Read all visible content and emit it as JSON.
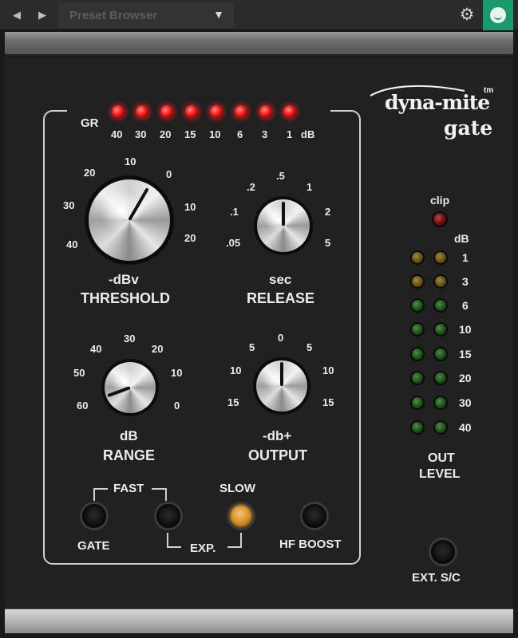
{
  "topbar": {
    "preset_label": "Preset Browser",
    "prev_icon": "◀",
    "next_icon": "▶",
    "dropdown_icon": "▼",
    "gear_icon": "⚙"
  },
  "logo": {
    "line1": "dyna-mite",
    "line2": "gate",
    "tm": "tm"
  },
  "gr": {
    "label": "GR",
    "ticks": [
      "40",
      "30",
      "20",
      "15",
      "10",
      "6",
      "3",
      "1"
    ],
    "unit": "dB",
    "led_color": "#ff2a2a"
  },
  "threshold": {
    "unit": "-dBv",
    "name": "THRESHOLD",
    "ticks": [
      "40",
      "30",
      "20",
      "10",
      "0",
      "10",
      "20"
    ]
  },
  "release": {
    "unit": "sec",
    "name": "RELEASE",
    "ticks": [
      ".05",
      ".1",
      ".2",
      ".5",
      "1",
      "2",
      "5"
    ]
  },
  "range": {
    "unit": "dB",
    "name": "RANGE",
    "ticks": [
      "60",
      "50",
      "40",
      "30",
      "20",
      "10",
      "0"
    ]
  },
  "output": {
    "unit": "-db+",
    "name": "OUTPUT",
    "ticks": [
      "15",
      "10",
      "5",
      "0",
      "5",
      "10",
      "15"
    ]
  },
  "switches": {
    "fast": "FAST",
    "slow": "SLOW",
    "gate": "GATE",
    "exp": "EXP.",
    "hf_boost": "HF BOOST"
  },
  "meter": {
    "clip": "clip",
    "unit": "dB",
    "ticks": [
      "1",
      "3",
      "6",
      "10",
      "15",
      "20",
      "30",
      "40"
    ],
    "out": "OUT",
    "level": "LEVEL"
  },
  "ext_sc": "EXT. S/C",
  "colors": {
    "panel": "#212121",
    "led_red": "#ff2a2a",
    "brand": "#1a9a6a",
    "slow_lit": "#d8922e"
  }
}
